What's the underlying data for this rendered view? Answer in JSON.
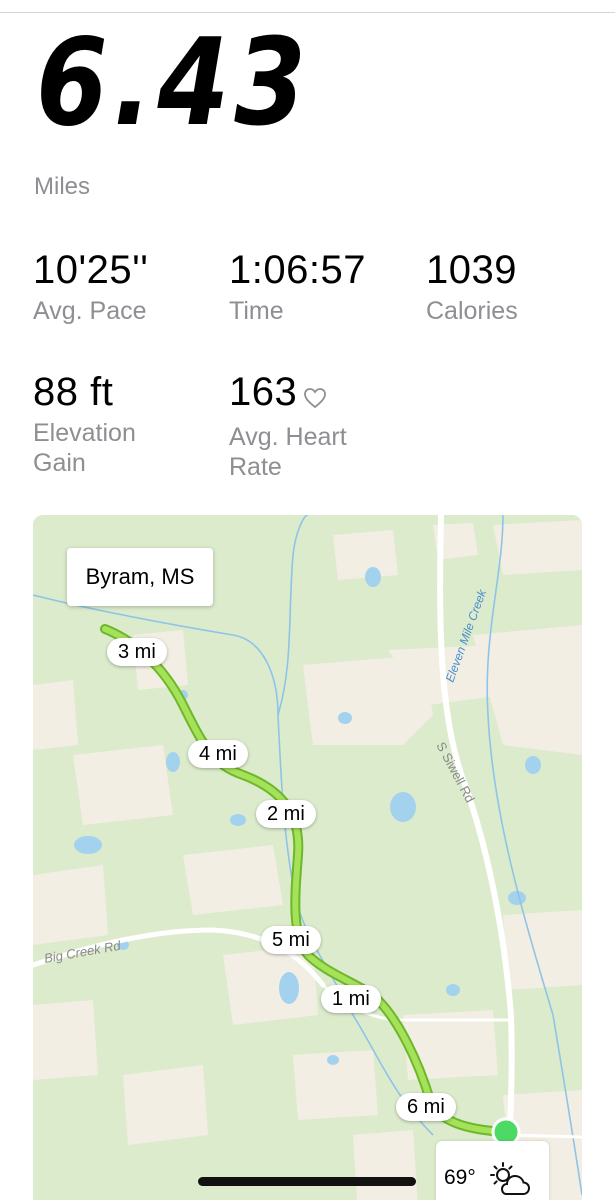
{
  "summary": {
    "distance": "6.43",
    "distance_unit": "Miles"
  },
  "stats": {
    "pace": {
      "value": "10'25''",
      "label": "Avg. Pace"
    },
    "time": {
      "value": "1:06:57",
      "label": "Time"
    },
    "calories": {
      "value": "1039",
      "label": "Calories"
    },
    "elevation": {
      "value": "88 ft",
      "label_line1": "Elevation",
      "label_line2": "Gain"
    },
    "heart_rate": {
      "value": "163",
      "label_line1": "Avg. Heart",
      "label_line2": "Rate",
      "icon": "heart-outline-icon"
    }
  },
  "map": {
    "place_label": "Byram, MS",
    "road_labels": {
      "big_creek": "Big Creek Rd",
      "siwell": "S Siwell Rd",
      "eleven_mile_creek": "Eleven Mile Creek"
    },
    "mile_markers": [
      "3 mi",
      "4 mi",
      "2 mi",
      "5 mi",
      "1 mi",
      "6 mi"
    ],
    "route_color": "#7ed321",
    "endpoint_color": "#4cd964",
    "weather": {
      "temperature": "69°",
      "icon": "partly-sunny-icon"
    }
  },
  "colors": {
    "label_gray": "#8e8e93",
    "map_background": "#eaf2df",
    "water": "#a3d2ee",
    "road": "#ffffff"
  }
}
